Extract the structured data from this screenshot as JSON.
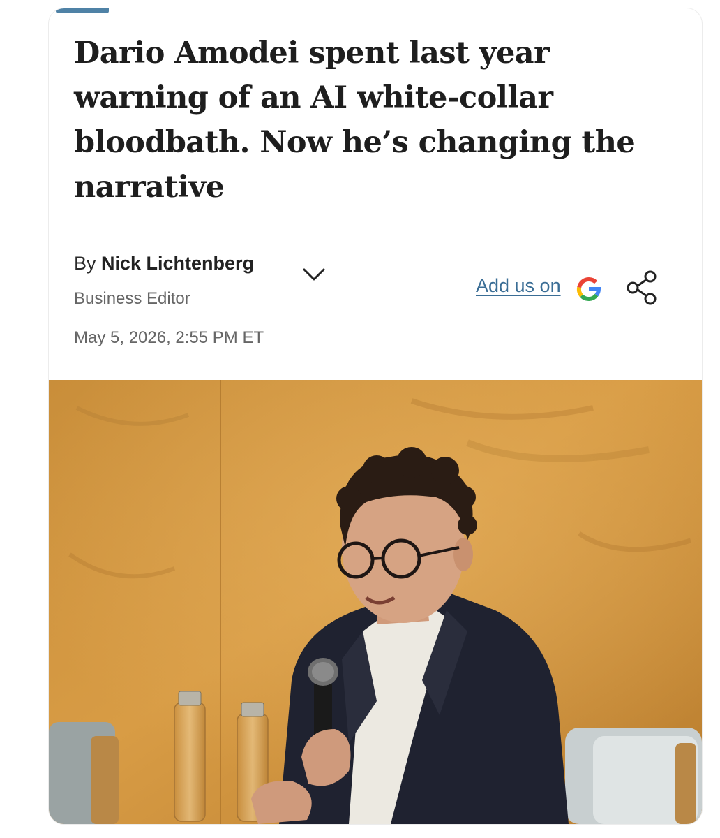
{
  "article": {
    "headline": "Dario Amodei spent last year warning of an AI white-collar bloodbath. Now he’s changing the narrative",
    "byline_prefix": "By ",
    "author": "Nick Lichtenberg",
    "author_role": "Business Editor",
    "timestamp": "May 5, 2026, 2:55 PM ET",
    "add_us_label": "Add us on"
  },
  "icons": {
    "author_expand": "chevron-down-icon",
    "google": "google-g-icon",
    "share": "share-icon"
  },
  "colors": {
    "accent": "#4f82a6",
    "link": "#3a6d95",
    "headline": "#1e1e1e",
    "meta": "#666666"
  }
}
